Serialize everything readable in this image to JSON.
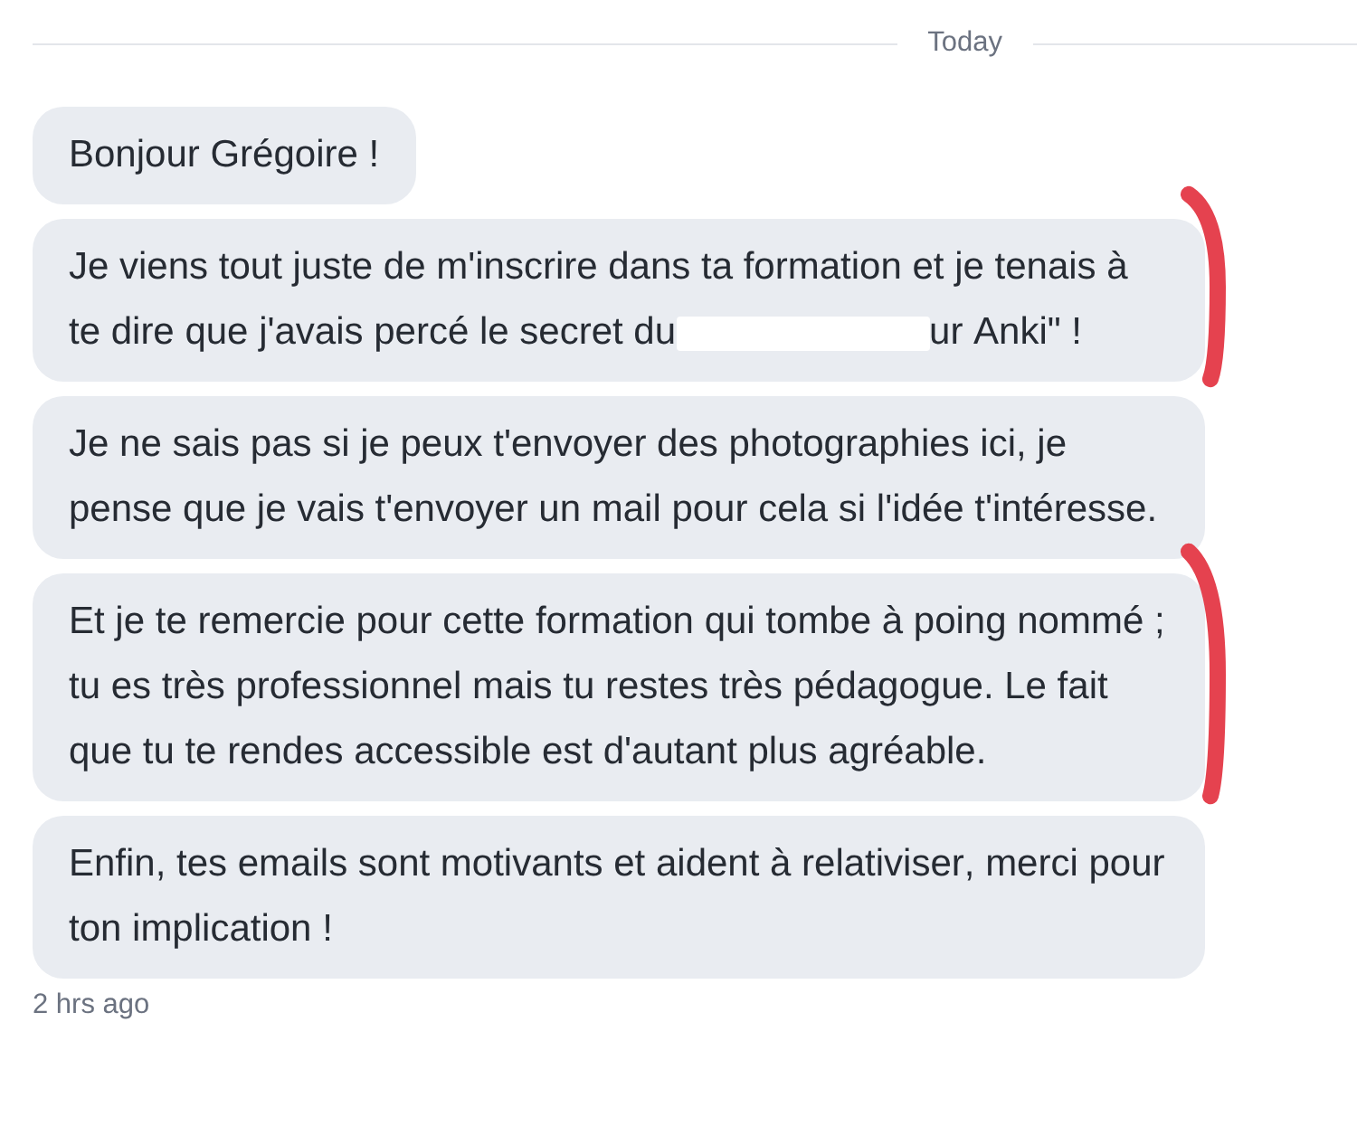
{
  "divider": {
    "label": "Today"
  },
  "messages": [
    {
      "marked": false,
      "parts": [
        {
          "kind": "text",
          "text": "Bonjour Grégoire !"
        }
      ]
    },
    {
      "marked": true,
      "parts": [
        {
          "kind": "text",
          "text": "Je viens tout juste de m'inscrire dans ta formation et je tenais à te dire que j'avais percé le secret du"
        },
        {
          "kind": "redaction"
        },
        {
          "kind": "text",
          "text": "ur Anki\" !"
        }
      ]
    },
    {
      "marked": false,
      "parts": [
        {
          "kind": "text",
          "text": "Je ne sais pas si je peux t'envoyer des photographies ici, je pense que je vais t'envoyer un mail pour cela si l'idée t'intéresse."
        }
      ]
    },
    {
      "marked": true,
      "parts": [
        {
          "kind": "text",
          "text": "Et je te remercie pour cette formation qui tombe à poing nommé ; tu es très professionnel mais tu restes très pédagogue. Le fait que tu te rendes accessible est d'autant plus agréable."
        }
      ]
    },
    {
      "marked": false,
      "parts": [
        {
          "kind": "text",
          "text": "Enfin, tes emails sont motivants et aident à relativiser, merci pour ton implication !"
        }
      ]
    }
  ],
  "timestamp": "2 hrs ago"
}
